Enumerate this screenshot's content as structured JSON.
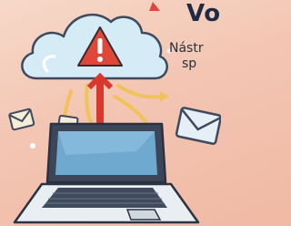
{
  "heading": {
    "title": "Vo",
    "subtitle_line1": "Nástr",
    "subtitle_line2": "sp"
  },
  "colors": {
    "background": "#f3c5b2",
    "cloud": "#cfe6f3",
    "warning": "#e24a3b",
    "arrow_red": "#d9382c",
    "arrow_yellow": "#f0c65a",
    "laptop": "#3f4a5c",
    "screen": "#6aa8cf"
  }
}
